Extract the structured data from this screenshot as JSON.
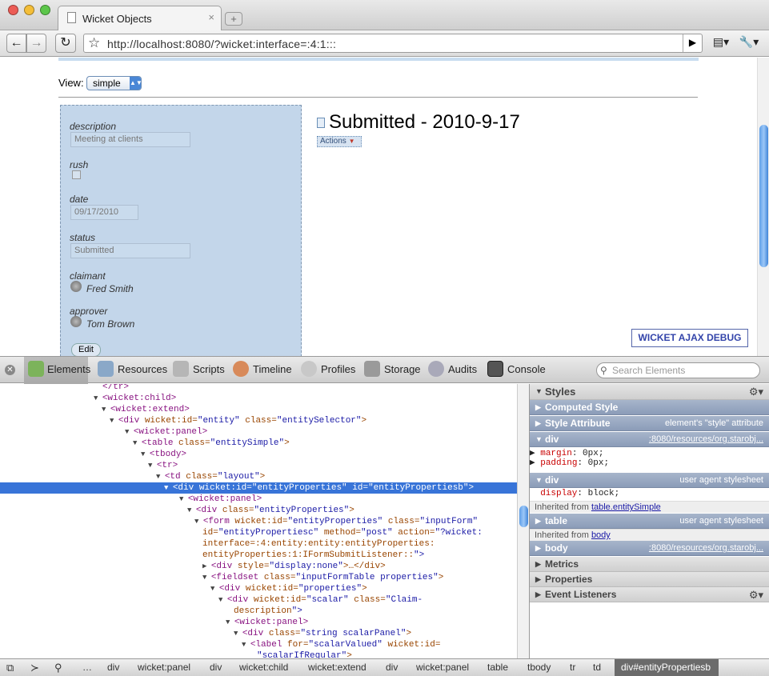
{
  "browser": {
    "tab_title": "Wicket Objects",
    "tab_close": "×",
    "new_tab": "+",
    "url": "http://localhost:8080/?wicket:interface=:4:1:::",
    "back": "←",
    "forward": "→",
    "reload": "↻",
    "go": "▶",
    "page_menu": "▤▾",
    "tools_menu": "🔧▾"
  },
  "page": {
    "view_label": "View:",
    "view_value": "simple",
    "fields": [
      {
        "label": "description",
        "value": "Meeting at clients"
      },
      {
        "label": "rush",
        "value": ""
      },
      {
        "label": "date",
        "value": "09/17/2010"
      },
      {
        "label": "status",
        "value": "Submitted"
      },
      {
        "label": "claimant",
        "value": "Fred Smith"
      },
      {
        "label": "approver",
        "value": "Tom Brown"
      }
    ],
    "edit_label": "Edit",
    "object_title": "Submitted - 2010-9-17",
    "actions_label": "Actions",
    "ajax_debug": "WICKET AJAX DEBUG"
  },
  "inspector": {
    "tabs": [
      "Elements",
      "Resources",
      "Scripts",
      "Timeline",
      "Profiles",
      "Storage",
      "Audits",
      "Console"
    ],
    "search_placeholder": "Search Elements",
    "dom_lines": [
      {
        "indent": 12,
        "tw": "▼",
        "tag": "<wicket:child>",
        "attrs": ""
      },
      {
        "indent": 13,
        "tw": "▼",
        "tag": "<wicket:extend>",
        "attrs": ""
      },
      {
        "indent": 14,
        "tw": "▼",
        "tag": "<div",
        "attrs": " wicket:id=\"entity\" class=\"entitySelector\">"
      },
      {
        "indent": 16,
        "tw": "▼",
        "tag": "<wicket:panel>",
        "attrs": ""
      },
      {
        "indent": 17,
        "tw": "▼",
        "tag": "<table",
        "attrs": " class=\"entitySimple\">"
      },
      {
        "indent": 18,
        "tw": "▼",
        "tag": "<tbody>",
        "attrs": ""
      },
      {
        "indent": 19,
        "tw": "▼",
        "tag": "<tr>",
        "attrs": ""
      },
      {
        "indent": 20,
        "tw": "▼",
        "tag": "<td",
        "attrs": " class=\"layout\">"
      },
      {
        "indent": 21,
        "tw": "▼",
        "tag": "<div",
        "attrs": " wicket:id=\"entityProperties\" id=\"entityPropertiesb\">",
        "selected": true
      },
      {
        "indent": 23,
        "tw": "▼",
        "tag": "<wicket:panel>",
        "attrs": ""
      },
      {
        "indent": 24,
        "tw": "▼",
        "tag": "<div",
        "attrs": " class=\"entityProperties\">"
      },
      {
        "indent": 25,
        "tw": "▼",
        "tag": "<form",
        "attrs": " wicket:id=\"entityProperties\" class=\"inputForm\""
      },
      {
        "indent": 26,
        "tw": "",
        "tag": "",
        "attrs": "id=\"entityPropertiesc\" method=\"post\" action=\"?wicket:"
      },
      {
        "indent": 26,
        "tw": "",
        "tag": "",
        "attrs": "interface=:4:entity:entity:entityProperties:"
      },
      {
        "indent": 26,
        "tw": "",
        "tag": "",
        "attrs": "entityProperties:1:IFormSubmitListener::\">"
      },
      {
        "indent": 26,
        "tw": "▶",
        "tag": "<div",
        "attrs": " style=\"display:none\">…</div>"
      },
      {
        "indent": 26,
        "tw": "▼",
        "tag": "<fieldset",
        "attrs": " class=\"inputFormTable properties\">"
      },
      {
        "indent": 27,
        "tw": "▼",
        "tag": "<div",
        "attrs": " wicket:id=\"properties\">"
      },
      {
        "indent": 28,
        "tw": "▼",
        "tag": "<div",
        "attrs": " wicket:id=\"scalar\" class=\"Claim-"
      },
      {
        "indent": 30,
        "tw": "",
        "tag": "",
        "attrs": "description\">"
      },
      {
        "indent": 29,
        "tw": "▼",
        "tag": "<wicket:panel>",
        "attrs": ""
      },
      {
        "indent": 30,
        "tw": "▼",
        "tag": "<div",
        "attrs": " class=\"string scalarPanel\">"
      },
      {
        "indent": 31,
        "tw": "▼",
        "tag": "<label",
        "attrs": " for=\"scalarValued\" wicket:id="
      },
      {
        "indent": 33,
        "tw": "",
        "tag": "",
        "attrs": "\"scalarIfRegular\">"
      }
    ],
    "sidebar": {
      "styles": "Styles",
      "computed_style": "Computed Style",
      "style_attribute": "Style Attribute",
      "style_attribute_note": "element's \"style\" attribute",
      "rule1_selector": "div",
      "rule1_source": ":8080/resources/org.starobj...",
      "rule1_props": [
        {
          "name": "margin",
          "value": "0px;"
        },
        {
          "name": "padding",
          "value": "0px;"
        }
      ],
      "rule2_selector": "div",
      "rule2_source": "user agent stylesheet",
      "rule2_props": [
        {
          "name": "display",
          "value": "block;"
        }
      ],
      "inherited1_prefix": "Inherited from",
      "inherited1_link": "table.entitySimple",
      "rule3_selector": "table",
      "rule3_source": "user agent stylesheet",
      "inherited2_prefix": "Inherited from",
      "inherited2_link": "body",
      "rule4_selector": "body",
      "rule4_source": ":8080/resources/org.starobj...",
      "metrics": "Metrics",
      "properties": "Properties",
      "event_listeners": "Event Listeners"
    },
    "breadcrumbs": [
      "…",
      "div",
      "wicket:panel",
      "div",
      "wicket:child",
      "wicket:extend",
      "div",
      "wicket:panel",
      "table",
      "tbody",
      "tr",
      "td"
    ],
    "breadcrumb_selected": "div#entityPropertiesb"
  },
  "colors": {
    "selection": "#3874d8",
    "panel_bg": "#c3d6ea",
    "tag": "#881280",
    "attr": "#994500",
    "value": "#1a1aa6"
  }
}
